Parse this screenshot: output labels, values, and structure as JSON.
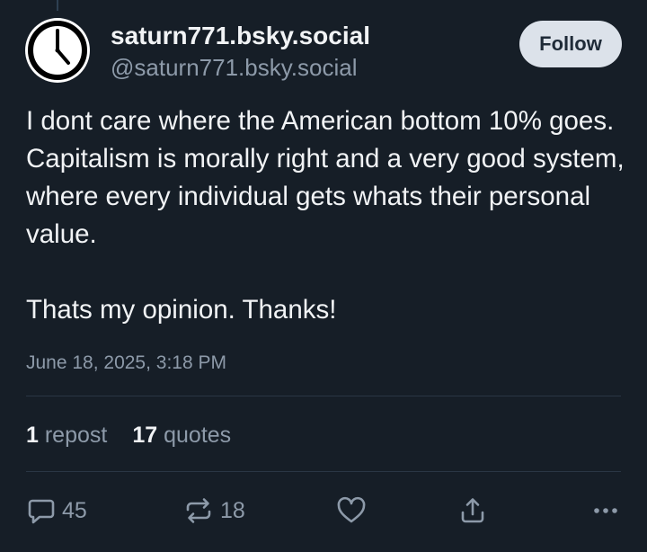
{
  "author": {
    "display_name": "saturn771.bsky.social",
    "handle": "@saturn771.bsky.social",
    "avatar_icon": "clock-icon"
  },
  "follow_button": {
    "label": "Follow"
  },
  "post": {
    "paragraphs": [
      "I dont care where the American bottom 10% goes. Capitalism is morally right and a very good system, where every individual gets whats their personal value.",
      "Thats my opinion. Thanks!"
    ],
    "timestamp": "June 18, 2025, 3:18 PM"
  },
  "stats": {
    "reposts_count": "1",
    "reposts_label": "repost",
    "quotes_count": "17",
    "quotes_label": "quotes"
  },
  "actions": {
    "reply": {
      "icon": "reply-bubble-icon",
      "count": "45"
    },
    "repost": {
      "icon": "repost-icon",
      "count": "18"
    },
    "like": {
      "icon": "heart-icon"
    },
    "share": {
      "icon": "share-icon"
    },
    "more": {
      "icon": "more-dots-icon"
    }
  },
  "colors": {
    "background": "#161e27",
    "text": "#f1f3f5",
    "muted": "#8d9aa9",
    "follow_button_bg": "#dce2ea"
  }
}
